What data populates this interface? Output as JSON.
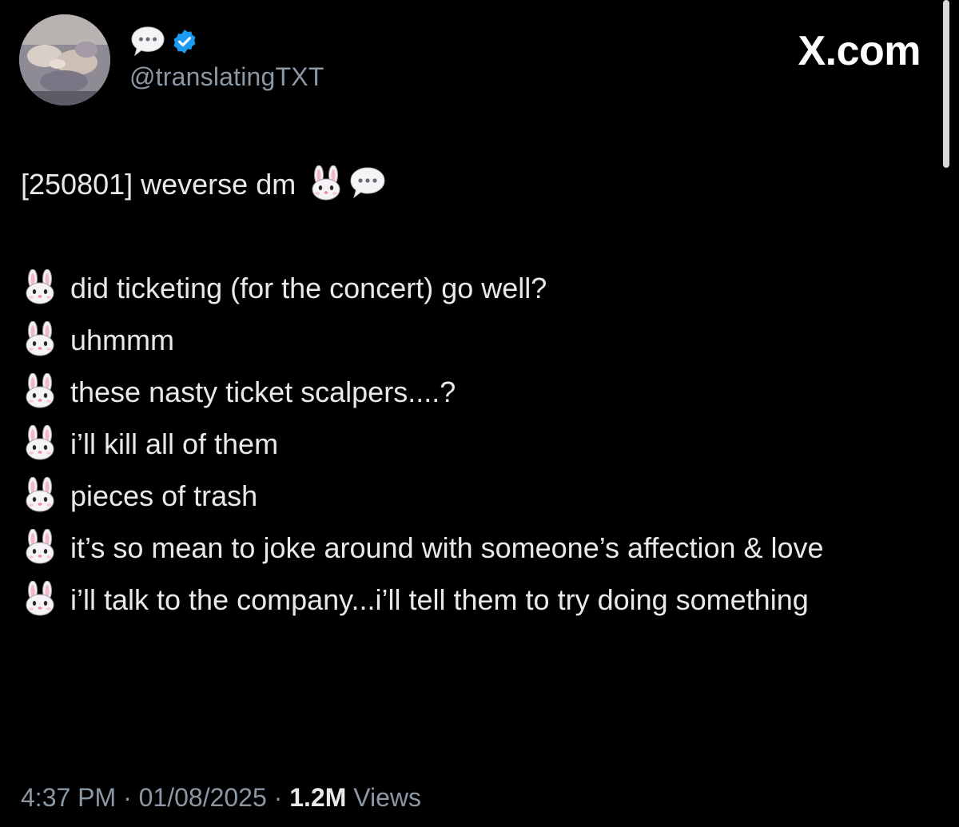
{
  "account": {
    "handle": "@translatingTXT",
    "verified": true,
    "avatar_icon": "group-photo-avatar",
    "name_icon": "speech-bubble-icon"
  },
  "site": {
    "label": "X.com"
  },
  "tweet": {
    "title": "[250801] weverse dm",
    "title_emojis": [
      "rabbit-face-icon",
      "speech-bubble-icon"
    ],
    "lines": [
      "did ticketing (for the concert) go well?",
      "uhmmm",
      "these nasty ticket scalpers....?",
      "i’ll kill all of them",
      "pieces of trash",
      "it’s so mean to joke around with someone’s affection & love",
      "i’ll talk to the company...i’ll tell them to try doing something"
    ],
    "line_icon": "rabbit-face-icon"
  },
  "meta": {
    "time": "4:37 PM",
    "separator": "·",
    "date": "01/08/2025",
    "views_count": "1.2M",
    "views_label": "Views"
  },
  "colors": {
    "background": "#000000",
    "text": "#e7e9ea",
    "secondary_text": "#8b98a5",
    "verified_badge": "#1d9bf0"
  }
}
